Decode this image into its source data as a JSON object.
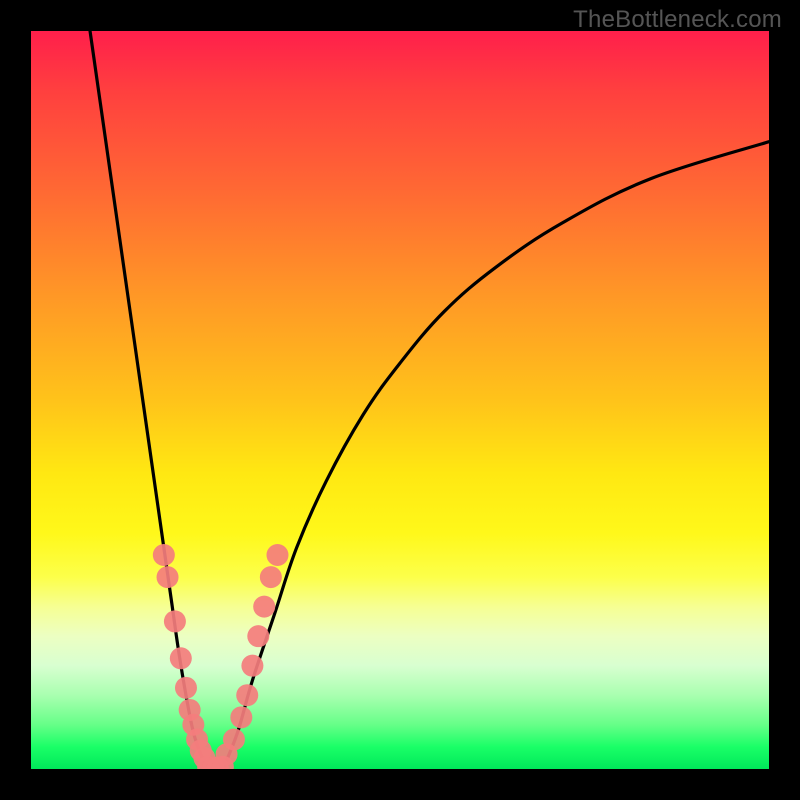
{
  "watermark": "TheBottleneck.com",
  "chart_data": {
    "type": "line",
    "title": "",
    "xlabel": "",
    "ylabel": "",
    "xlim": [
      0,
      100
    ],
    "ylim": [
      0,
      100
    ],
    "grid": false,
    "legend": false,
    "background": "rainbow-gradient (red top → green bottom)",
    "series": [
      {
        "name": "left-branch",
        "x": [
          8,
          10,
          12,
          14,
          16,
          18,
          19,
          20,
          21,
          22,
          23,
          24
        ],
        "y": [
          100,
          86,
          72,
          58,
          44,
          30,
          23,
          16,
          10,
          5,
          2,
          0
        ]
      },
      {
        "name": "right-branch",
        "x": [
          26,
          28,
          30,
          33,
          36,
          40,
          45,
          50,
          56,
          63,
          72,
          84,
          100
        ],
        "y": [
          0,
          5,
          12,
          21,
          30,
          39,
          48,
          55,
          62,
          68,
          74,
          80,
          85
        ]
      },
      {
        "name": "markers-left",
        "type": "scatter",
        "x": [
          18.0,
          18.5,
          19.5,
          20.3,
          21.0,
          21.5,
          22.0,
          22.5,
          23.0,
          23.5
        ],
        "y": [
          29,
          26,
          20,
          15,
          11,
          8,
          6,
          4,
          2.5,
          1.5
        ]
      },
      {
        "name": "markers-right",
        "type": "scatter",
        "x": [
          26.5,
          27.5,
          28.5,
          29.3,
          30.0,
          30.8,
          31.6,
          32.5,
          33.4
        ],
        "y": [
          2,
          4,
          7,
          10,
          14,
          18,
          22,
          26,
          29
        ]
      },
      {
        "name": "flat-bottom",
        "type": "scatter",
        "x": [
          24.0,
          24.7,
          25.3,
          26.0
        ],
        "y": [
          0.3,
          0.2,
          0.2,
          0.3
        ]
      }
    ],
    "colors": {
      "curve": "#000000",
      "markers": "#f47d7d"
    }
  }
}
